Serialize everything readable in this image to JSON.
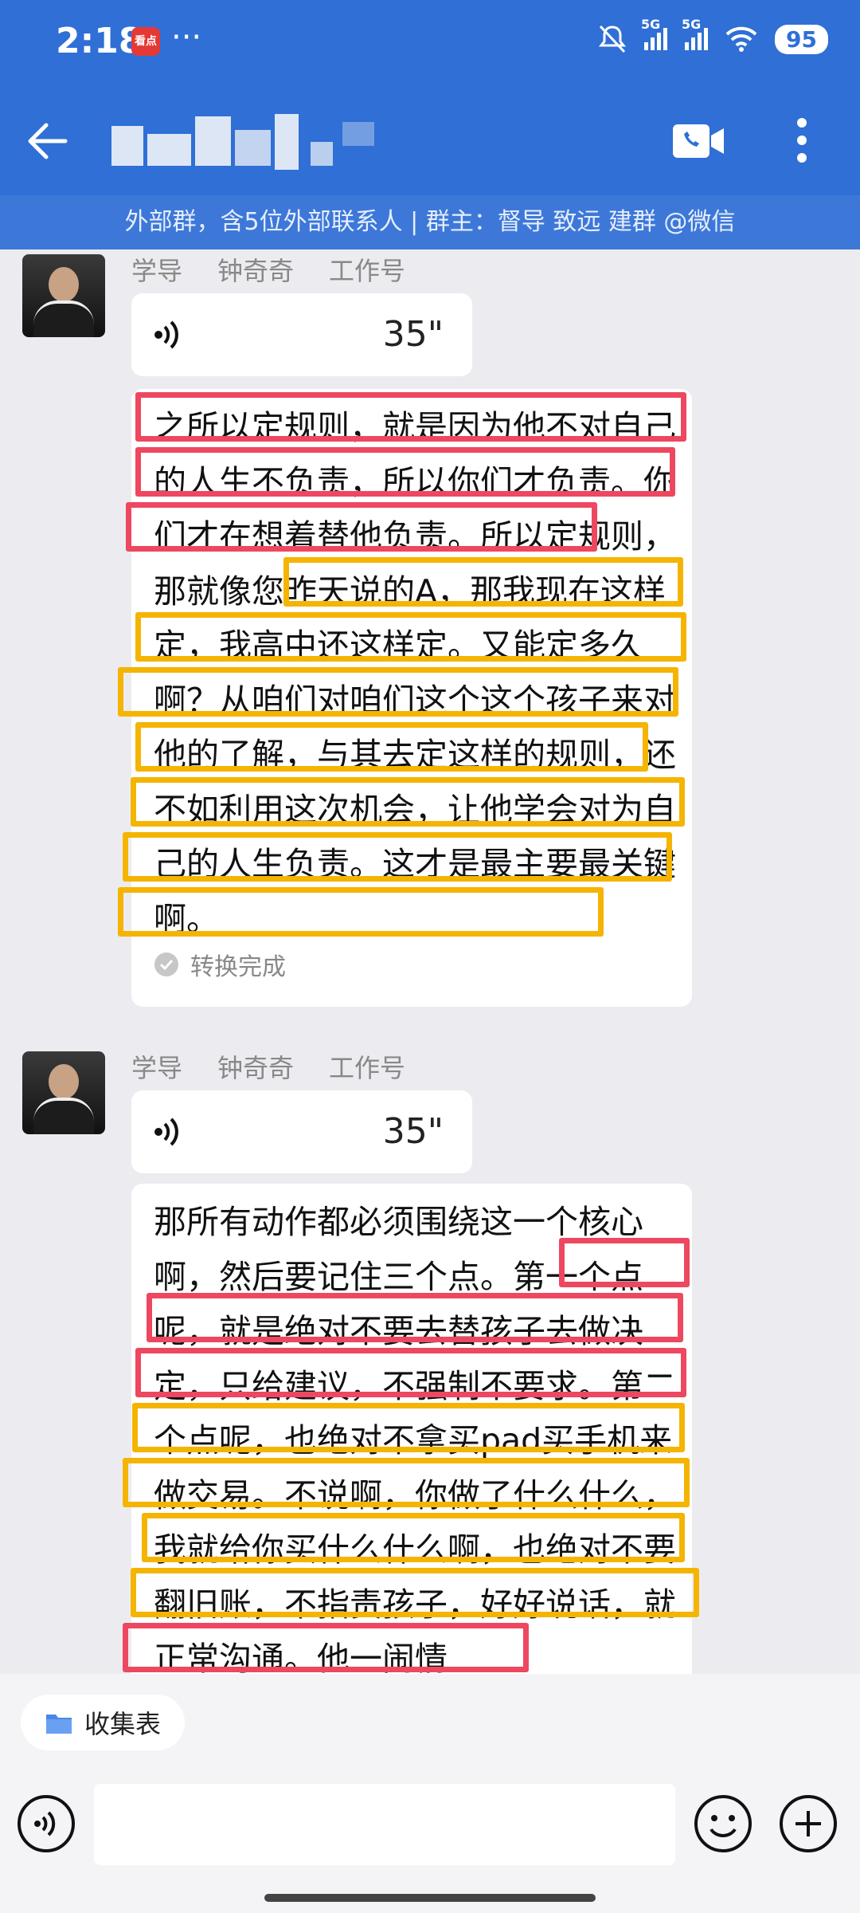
{
  "status": {
    "time": "2:18",
    "app_badge": "看点",
    "dots": "···",
    "signal1": "5G",
    "signal2": "5G",
    "battery": "95"
  },
  "header": {
    "banner": "外部群，含5位外部联系人 | 群主：督导  致远    建群 @微信"
  },
  "messages": [
    {
      "sender": {
        "role": "学导",
        "name": "钟奇奇",
        "tag": "工作号"
      },
      "voice_duration": "35\"",
      "transcript": "之所以定规则，就是因为他不对自己的人生不负责，所以你们才负责。你们才在想着替他负责。所以定规则，那就像您昨天说的A，那我现在这样定，我高中还这样定。又能定多久啊？从咱们对咱们这个这个孩子来对他的了解，与其去定这样的规则，还不如利用这次机会，让他学会对为自己的人生负责。这才是最主要最关键啊。",
      "status": "转换完成"
    },
    {
      "sender": {
        "role": "学导",
        "name": "钟奇奇",
        "tag": "工作号"
      },
      "voice_duration": "35\"",
      "transcript": "那所有动作都必须围绕这一个核心啊，然后要记住三个点。第一个点呢，就是绝对不要去替孩子去做决定，只给建议，不强制不要求。第二个点呢，也绝对不拿买pad买手机来做交易。不说啊，你做了什么什么，我就给你买什么什么啊，也绝对不要翻旧账，不指责孩子，好好说话，就正常沟通。他一闹情"
    }
  ],
  "composer": {
    "chip_label": "收集表",
    "input_value": ""
  },
  "colors": {
    "header": "#2f6fd6",
    "highlight_red": "#ee4760",
    "highlight_yellow": "#f4b400"
  },
  "icons": [
    "back-arrow-icon",
    "video-call-icon",
    "more-vertical-icon",
    "voice-wave-icon",
    "check-circle-icon",
    "folder-icon",
    "voice-input-icon",
    "emoji-icon",
    "plus-icon",
    "mute-icon",
    "wifi-icon"
  ]
}
